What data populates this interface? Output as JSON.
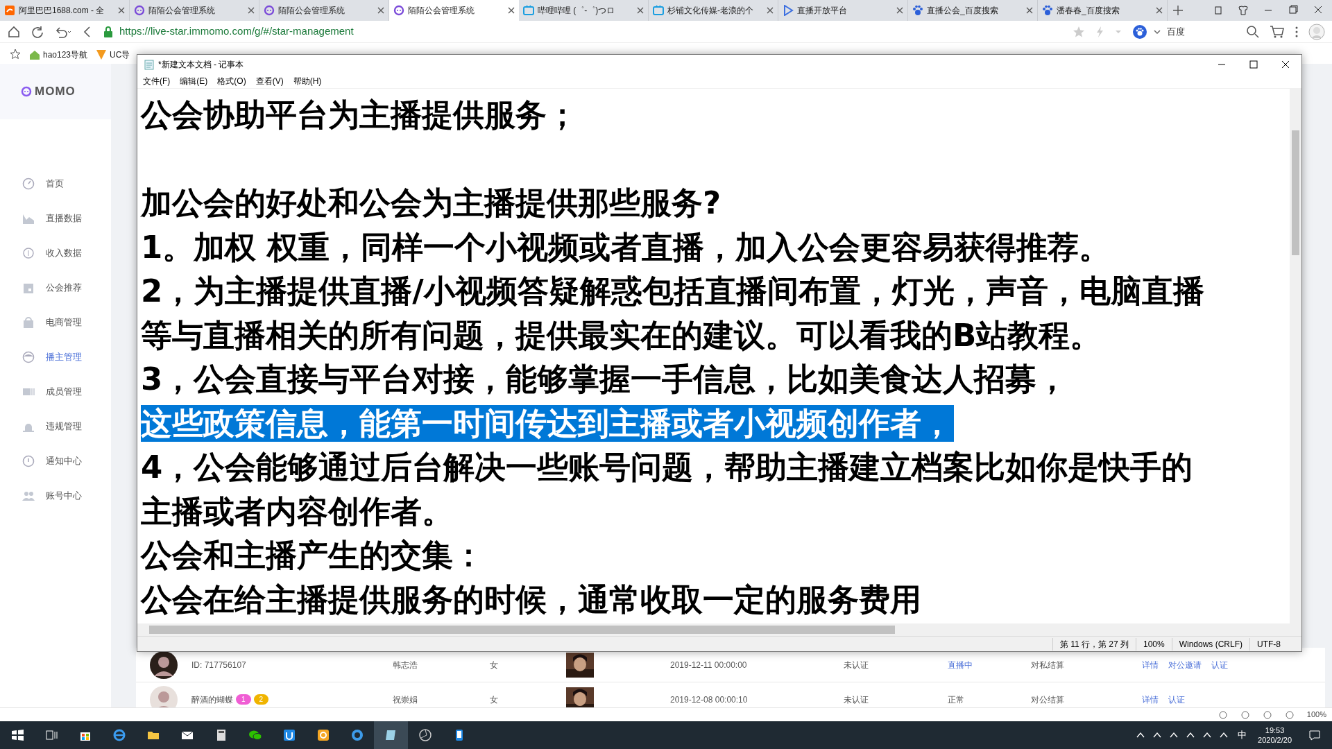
{
  "browser": {
    "tabs": [
      {
        "title": "阿里巴巴1688.com - 全",
        "selected": false
      },
      {
        "title": "陌陌公会管理系统",
        "selected": false
      },
      {
        "title": "陌陌公会管理系统",
        "selected": false
      },
      {
        "title": "陌陌公会管理系统",
        "selected": true
      },
      {
        "title": "哔哩哔哩 (゜-゜)つロ",
        "selected": false
      },
      {
        "title": "杉铺文化传媒-老浪的个",
        "selected": false
      },
      {
        "title": "直播开放平台",
        "selected": false
      },
      {
        "title": "直播公会_百度搜索",
        "selected": false
      },
      {
        "title": "潘春春_百度搜索",
        "selected": false
      }
    ],
    "url": "https://live-star.immomo.com/g/#/star-management",
    "search_engine": "百度",
    "bookmarks": [
      "hao123导航",
      "UC导"
    ],
    "zoom": "100%"
  },
  "sidebar": {
    "logo": "MOMO",
    "items": [
      {
        "label": "首页",
        "selected": false
      },
      {
        "label": "直播数据",
        "selected": false
      },
      {
        "label": "收入数据",
        "selected": false
      },
      {
        "label": "公会推荐",
        "selected": false
      },
      {
        "label": "电商管理",
        "selected": false
      },
      {
        "label": "播主管理",
        "selected": true
      },
      {
        "label": "成员管理",
        "selected": false
      },
      {
        "label": "违规管理",
        "selected": false
      },
      {
        "label": "通知中心",
        "selected": false
      },
      {
        "label": "账号中心",
        "selected": false
      }
    ]
  },
  "table_rows": [
    {
      "name": "ID: 717756107",
      "badges": [],
      "column_3": "韩志浩",
      "gender": "女",
      "date": "2019-12-11 00:00:00",
      "verify": "未认证",
      "status": "直播中",
      "status_live": true,
      "settlement": "对私结算",
      "actions": [
        "详情",
        "对公邀请",
        "认证"
      ]
    },
    {
      "name": "醉酒的蝴蝶",
      "badges": [
        "1",
        "2"
      ],
      "column_3": "祝崇娟",
      "gender": "女",
      "date": "2019-12-08 00:00:10",
      "verify": "未认证",
      "status": "正常",
      "status_live": false,
      "settlement": "对公结算",
      "actions": [
        "详情",
        "认证"
      ]
    }
  ],
  "notepad": {
    "title": "*新建文本文档 - 记事本",
    "menu": [
      "文件(F)",
      "编辑(E)",
      "格式(O)",
      "查看(V)",
      "帮助(H)"
    ],
    "lines": [
      {
        "text": "公会协助平台为主播提供服务；",
        "selected": false,
        "blank_before": false
      },
      {
        "text": "加公会的好处和公会为主播提供那些服务?",
        "selected": false,
        "blank_before": true
      },
      {
        "text": "1。加权 权重，同样一个小视频或者直播，加入公会更容易获得推荐。",
        "selected": false,
        "blank_before": false
      },
      {
        "text": "2，为主播提供直播/小视频答疑解惑包括直播间布置，灯光，声音，电脑直播",
        "selected": false,
        "blank_before": false
      },
      {
        "text": "等与直播相关的所有问题，提供最实在的建议。可以看我的B站教程。",
        "selected": false,
        "blank_before": false
      },
      {
        "text": "3，公会直接与平台对接，能够掌握一手信息，比如美食达人招募，",
        "selected": false,
        "blank_before": false
      },
      {
        "text": "这些政策信息，能第一时间传达到主播或者小视频创作者，",
        "selected": true,
        "blank_before": false
      },
      {
        "text": "4，公会能够通过后台解决一些账号问题，帮助主播建立档案比如你是快手的",
        "selected": false,
        "blank_before": false
      },
      {
        "text": "主播或者内容创作者。",
        "selected": false,
        "blank_before": false
      },
      {
        "text": "公会和主播产生的交集：",
        "selected": false,
        "blank_before": false
      },
      {
        "text": "公会在给主播提供服务的时候，通常收取一定的服务费用",
        "selected": false,
        "blank_before": false
      }
    ],
    "status": [
      "第 11 行，第 27 列",
      "100%",
      "Windows (CRLF)",
      "UTF-8"
    ]
  },
  "taskbar": {
    "ime": "中",
    "time": "19:53",
    "date": "2020/2/20"
  }
}
